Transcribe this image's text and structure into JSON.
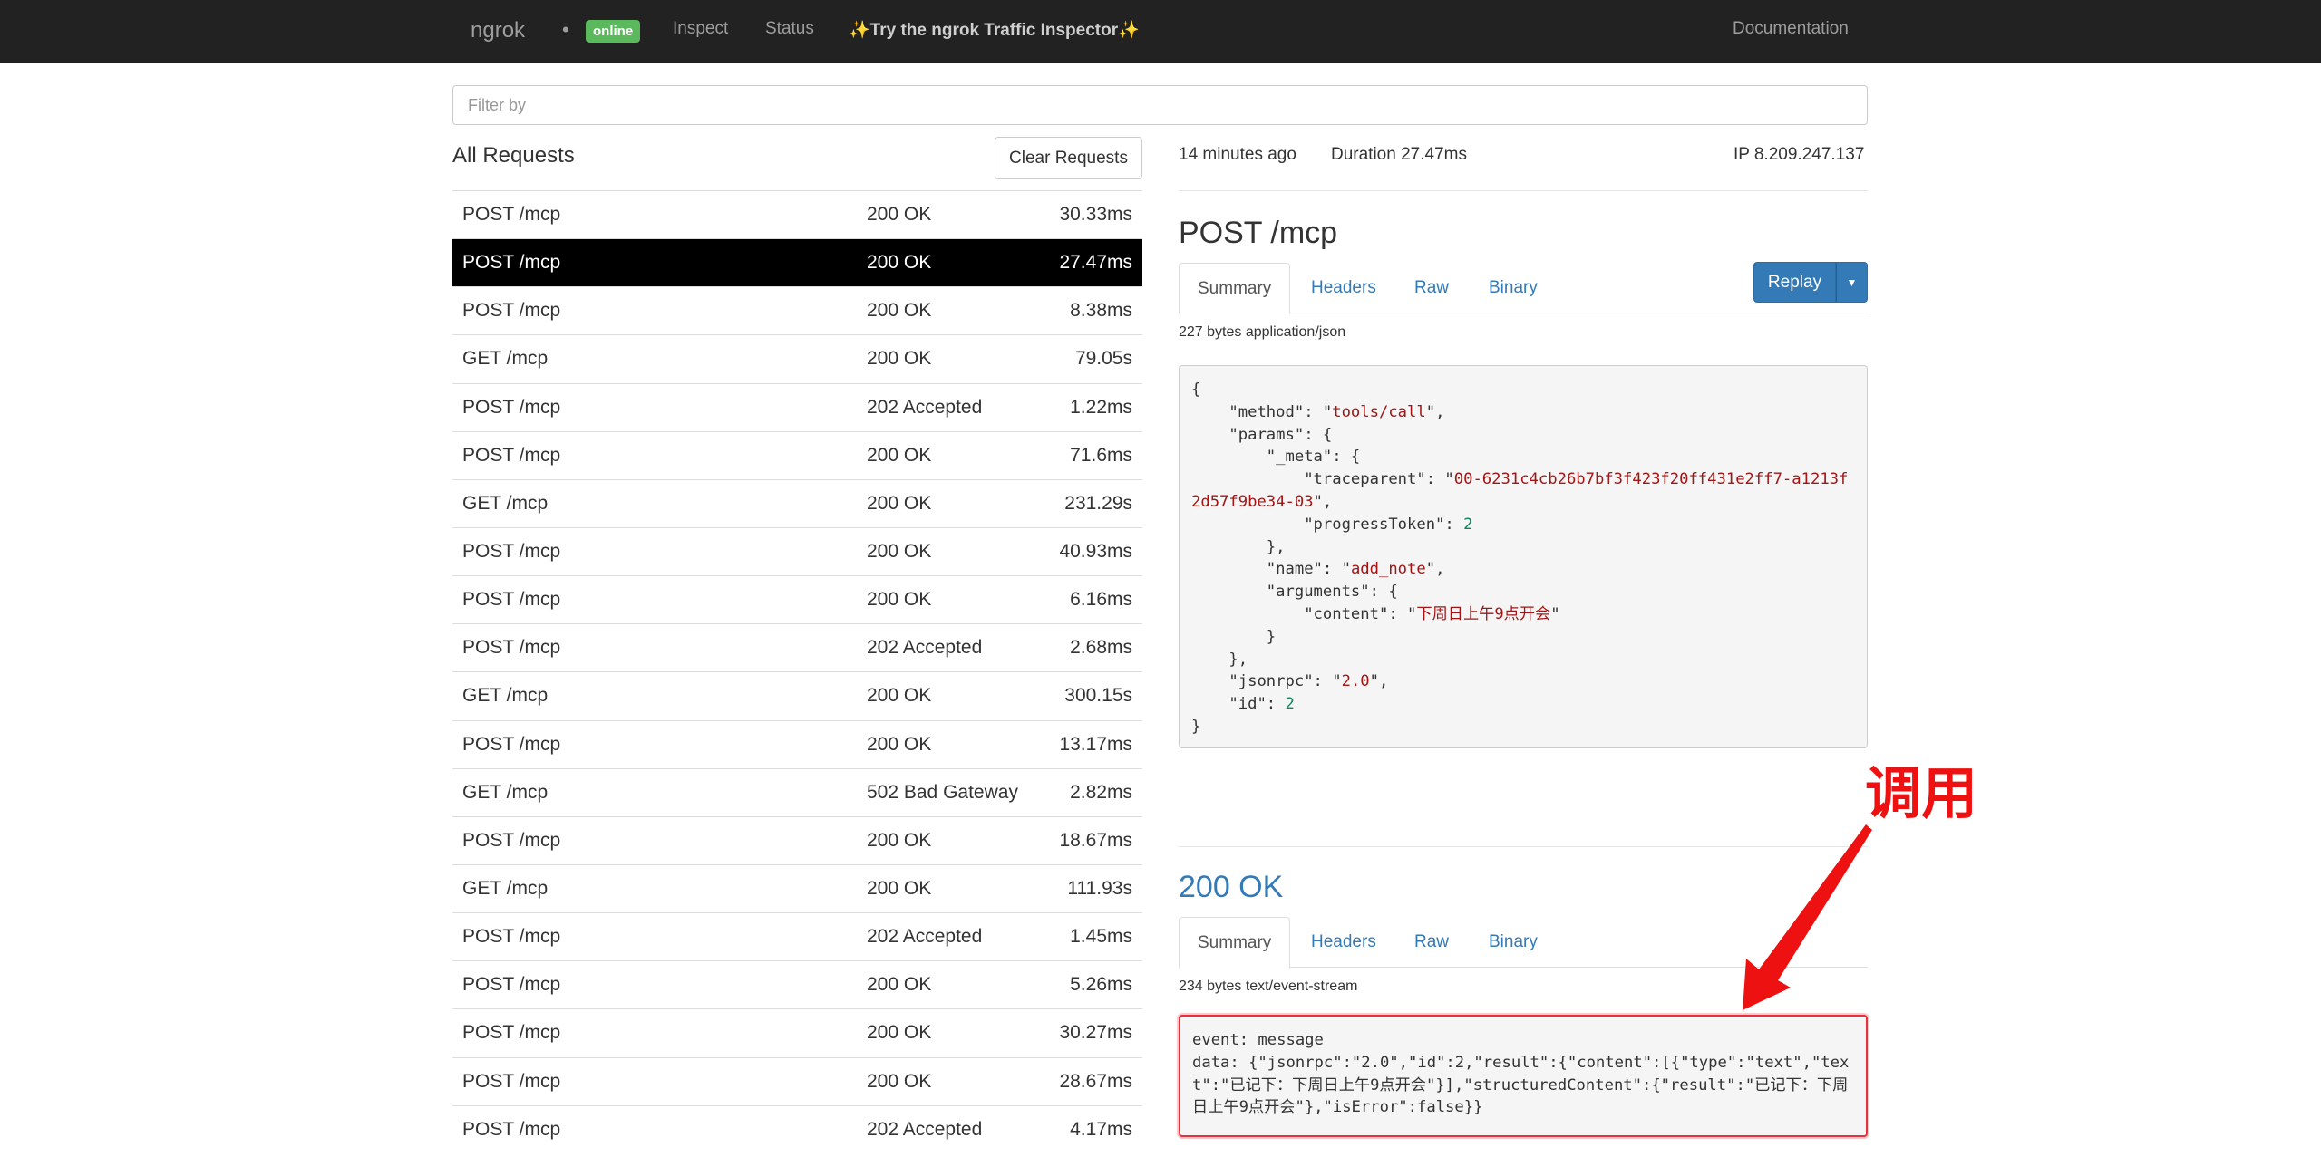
{
  "navbar": {
    "brand": "ngrok",
    "separator": "•",
    "status_badge": "online",
    "links": {
      "inspect": "Inspect",
      "status": "Status",
      "try_inspector": "✨Try the ngrok Traffic Inspector✨",
      "documentation": "Documentation"
    }
  },
  "filter": {
    "placeholder": "Filter by",
    "value": ""
  },
  "requests_panel": {
    "title": "All Requests",
    "clear_label": "Clear Requests",
    "selected_index": 1,
    "rows": [
      {
        "method_path": "POST /mcp",
        "status": "200 OK",
        "duration": "30.33ms"
      },
      {
        "method_path": "POST /mcp",
        "status": "200 OK",
        "duration": "27.47ms"
      },
      {
        "method_path": "POST /mcp",
        "status": "200 OK",
        "duration": "8.38ms"
      },
      {
        "method_path": "GET /mcp",
        "status": "200 OK",
        "duration": "79.05s"
      },
      {
        "method_path": "POST /mcp",
        "status": "202 Accepted",
        "duration": "1.22ms"
      },
      {
        "method_path": "POST /mcp",
        "status": "200 OK",
        "duration": "71.6ms"
      },
      {
        "method_path": "GET /mcp",
        "status": "200 OK",
        "duration": "231.29s"
      },
      {
        "method_path": "POST /mcp",
        "status": "200 OK",
        "duration": "40.93ms"
      },
      {
        "method_path": "POST /mcp",
        "status": "200 OK",
        "duration": "6.16ms"
      },
      {
        "method_path": "POST /mcp",
        "status": "202 Accepted",
        "duration": "2.68ms"
      },
      {
        "method_path": "GET /mcp",
        "status": "200 OK",
        "duration": "300.15s"
      },
      {
        "method_path": "POST /mcp",
        "status": "200 OK",
        "duration": "13.17ms"
      },
      {
        "method_path": "GET /mcp",
        "status": "502 Bad Gateway",
        "duration": "2.82ms"
      },
      {
        "method_path": "POST /mcp",
        "status": "200 OK",
        "duration": "18.67ms"
      },
      {
        "method_path": "GET /mcp",
        "status": "200 OK",
        "duration": "111.93s"
      },
      {
        "method_path": "POST /mcp",
        "status": "202 Accepted",
        "duration": "1.45ms"
      },
      {
        "method_path": "POST /mcp",
        "status": "200 OK",
        "duration": "5.26ms"
      },
      {
        "method_path": "POST /mcp",
        "status": "200 OK",
        "duration": "30.27ms"
      },
      {
        "method_path": "POST /mcp",
        "status": "200 OK",
        "duration": "28.67ms"
      },
      {
        "method_path": "POST /mcp",
        "status": "202 Accepted",
        "duration": "4.17ms"
      }
    ]
  },
  "detail": {
    "time_ago": "14 minutes ago",
    "duration": "Duration  27.47ms",
    "ip": "IP  8.209.247.137",
    "request": {
      "title": "POST /mcp",
      "tabs": [
        "Summary",
        "Headers",
        "Raw",
        "Binary"
      ],
      "active_tab": "Summary",
      "replay_label": "Replay",
      "bytes_info": "227 bytes application/json",
      "body": {
        "method": "tools/call",
        "traceparent": "00-6231c4cb26b7bf3f423f20ff431e2ff7-a1213f2d57f9be34-03",
        "progressToken": "2",
        "name": "add_note",
        "content": "下周日上午9点开会",
        "jsonrpc": "2.0",
        "id": "2"
      }
    },
    "response": {
      "title": "200 OK",
      "tabs": [
        "Summary",
        "Headers",
        "Raw",
        "Binary"
      ],
      "active_tab": "Summary",
      "bytes_info": "234 bytes text/event-stream",
      "event_line": "event: message",
      "data_line": "data: {\"jsonrpc\":\"2.0\",\"id\":2,\"result\":{\"content\":[{\"type\":\"text\",\"text\":\"已记下：下周日上午9点开会\"}],\"structuredContent\":{\"result\":\"已记下：下周日上午9点开会\"},\"isError\":false}}"
    }
  },
  "annotation": {
    "text": "调用",
    "color": "#ee1111"
  },
  "colors": {
    "navbar_bg": "#222222",
    "online_badge": "#5cb85c",
    "link": "#337ab7",
    "selected_row": "#000000"
  }
}
